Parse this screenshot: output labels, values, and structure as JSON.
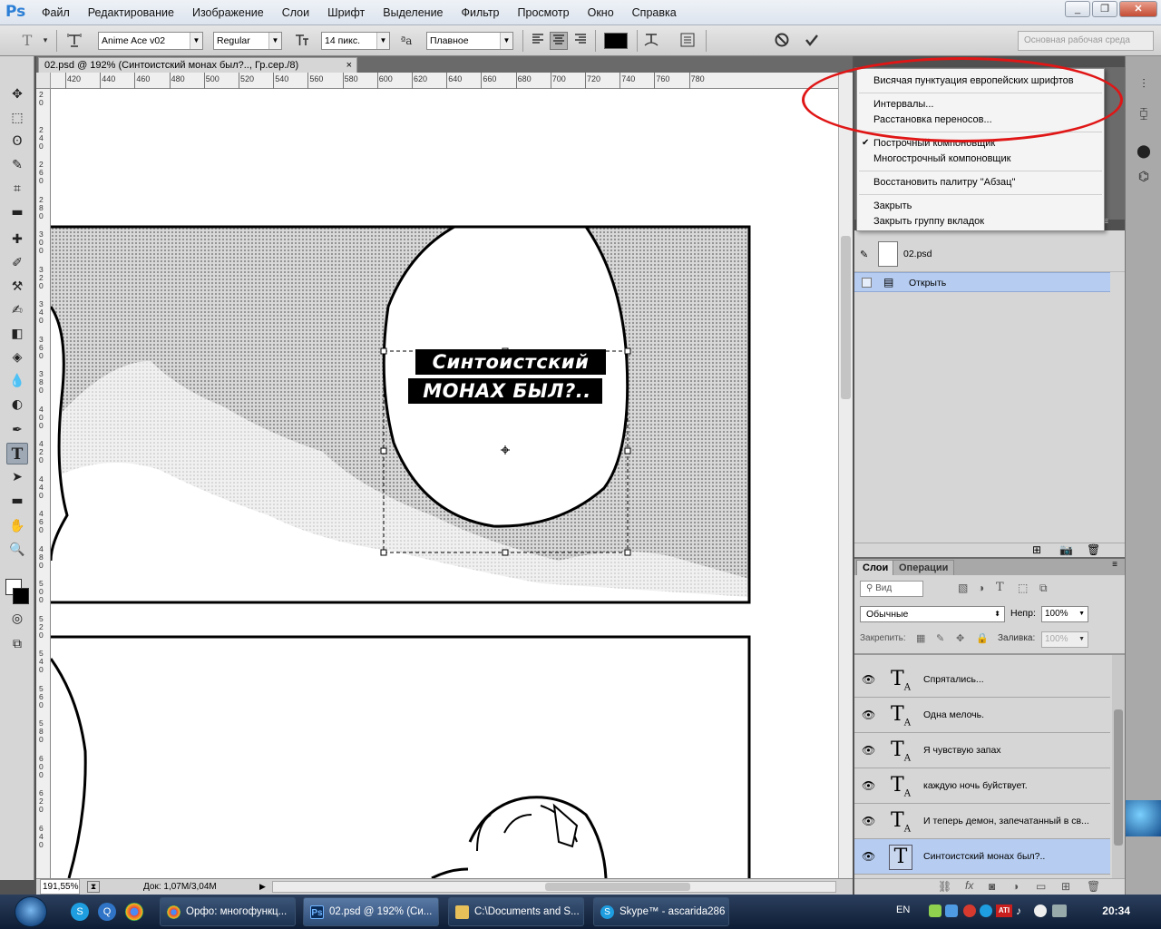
{
  "app": {
    "logo": "Ps",
    "menu": [
      "Файл",
      "Редактирование",
      "Изображение",
      "Слои",
      "Шрифт",
      "Выделение",
      "Фильтр",
      "Просмотр",
      "Окно",
      "Справка"
    ],
    "window_controls": [
      "_",
      "❐",
      "✕"
    ]
  },
  "options": {
    "tool_icon": "T",
    "font_family": "Anime Ace v02",
    "font_style": "Regular",
    "font_size": "14 пикс.",
    "aa_label": "ªa",
    "antialias": "Плавное",
    "text_color": "#000000",
    "workspace": "Основная рабочая среда"
  },
  "document": {
    "tab_title": "02.psd @ 192% (Синтоистский   монах был?.., Гр.сер./8)",
    "tab_close": "×",
    "zoom": "191,55%",
    "doc_info": "Док: 1,07M/3,04M",
    "text_line1": "Синтоистский",
    "text_line2": "монах был?..",
    "ruler_ticks": [
      "420",
      "440",
      "460",
      "480",
      "500",
      "520",
      "540",
      "560",
      "580",
      "600",
      "620",
      "640",
      "660",
      "680",
      "700",
      "720",
      "740",
      "760",
      "780"
    ],
    "ruler_v_labels": [
      "2\n0",
      "2\n4\n0",
      "2\n6\n0",
      "2\n8\n0",
      "3\n0\n0",
      "3\n2\n0",
      "3\n4\n0",
      "3\n6\n0",
      "3\n8\n0",
      "4\n0\n0",
      "4\n2\n0",
      "4\n4\n0",
      "4\n6\n0",
      "4\n8\n0",
      "5\n0\n0",
      "5\n2\n0",
      "5\n4\n0",
      "5\n6\n0",
      "5\n8\n0",
      "6\n0\n0",
      "6\n2\n0",
      "6\n4\n0"
    ]
  },
  "paragraph_menu": {
    "items": [
      {
        "label": "Висячая пунктуация европейских шрифтов",
        "checked": false
      },
      {
        "label": "Интервалы...",
        "checked": false
      },
      {
        "label": "Расстановка переносов...",
        "checked": false
      },
      {
        "label": "Построчный компоновщик",
        "checked": true
      },
      {
        "label": "Многострочный компоновщик",
        "checked": false
      },
      {
        "label": "Восстановить палитру \"Абзац\"",
        "checked": false
      },
      {
        "label": "Закрыть",
        "checked": false
      },
      {
        "label": "Закрыть группу вкладок",
        "checked": false
      }
    ],
    "highlight_color": "#e01616"
  },
  "history": {
    "snapshot_name": "02.psd",
    "step": "Открыть"
  },
  "layers": {
    "tabs": [
      "Слои",
      "Операции"
    ],
    "filter": "Вид",
    "blend_mode": "Обычные",
    "opacity_label": "Непр:",
    "opacity": "100%",
    "lock_label": "Закрепить:",
    "fill_label": "Заливка:",
    "fill": "100%",
    "items": [
      {
        "name": "Спрятались...",
        "selected": false
      },
      {
        "name": "Одна  мелочь.",
        "selected": false
      },
      {
        "name": " Я чувствую запах",
        "selected": false
      },
      {
        "name": "каждую ночь  буйствует.",
        "selected": false
      },
      {
        "name": "И теперь  демон,  запечатанный    в св...",
        "selected": false
      },
      {
        "name": "Синтоистский    монах был?..",
        "selected": true
      }
    ],
    "selection_color": "#b6cdf1"
  },
  "taskbar": {
    "buttons": [
      {
        "label": "Орфо: многофункц...",
        "icon": "chrome-icon",
        "active": false
      },
      {
        "label": "02.psd @ 192% (Си...",
        "icon": "photoshop-icon",
        "active": true
      },
      {
        "label": "C:\\Documents and S...",
        "icon": "folder-icon",
        "active": false
      },
      {
        "label": "Skype™ - ascarida286",
        "icon": "skype-icon",
        "active": false
      }
    ],
    "language": "EN",
    "clock": "20:34"
  }
}
